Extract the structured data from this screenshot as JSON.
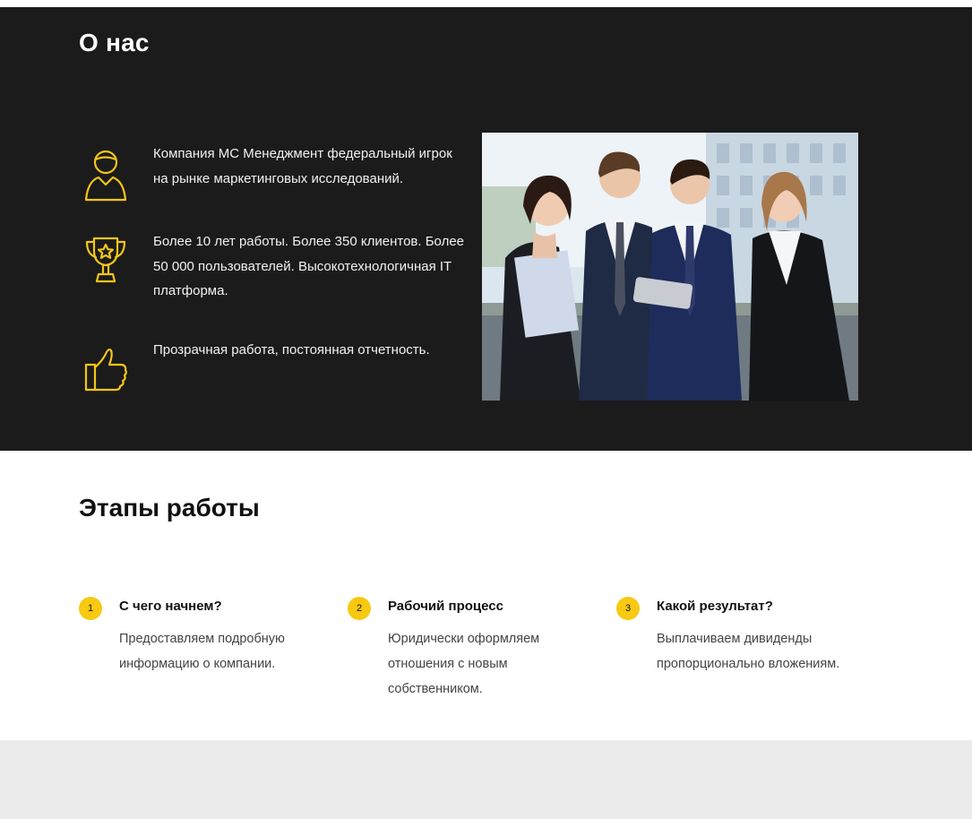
{
  "about": {
    "title": "О нас",
    "features": [
      {
        "icon": "user-icon",
        "text": "Компания МС Менеджмент федеральный игрок на рынке маркетинговых исследований."
      },
      {
        "icon": "trophy-icon",
        "text": "Более 10 лет работы. Более 350 клиентов. Более 50 000 пользователей. Высокотехнологичная IT платформа."
      },
      {
        "icon": "thumbs-up-icon",
        "text": "Прозрачная работа, постоянная отчетность."
      }
    ],
    "photo": "team-photo"
  },
  "stages": {
    "title": "Этапы работы",
    "steps": [
      {
        "number": "1",
        "title": "С чего начнем?",
        "text": "Предоставляем подробную информацию о компании."
      },
      {
        "number": "2",
        "title": "Рабочий процесс",
        "text": "Юридически оформляем отношения с новым собственником."
      },
      {
        "number": "3",
        "title": "Какой результат?",
        "text": "Выплачиваем дивиденды пропорционально вложениям."
      }
    ]
  },
  "colors": {
    "dark_bg": "#1b1b1b",
    "accent": "#f7c911",
    "footer_bg": "#ebebeb"
  }
}
